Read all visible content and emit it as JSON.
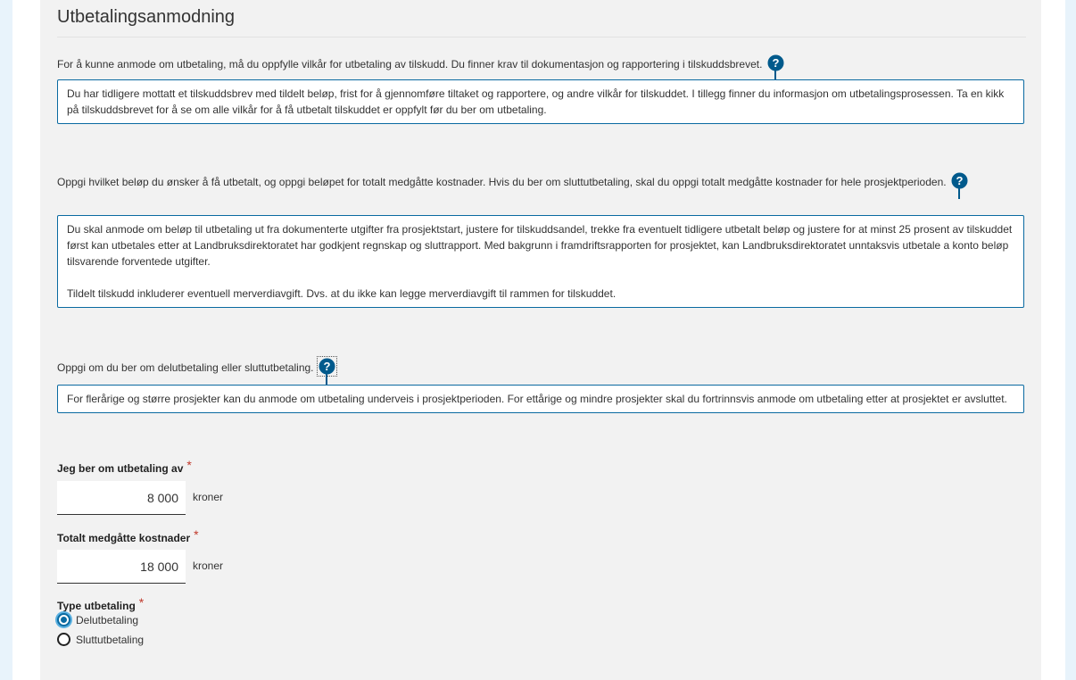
{
  "title": "Utbetalingsanmodning",
  "section1": {
    "intro": "For å kunne anmode om utbetaling, må du oppfylle vilkår for utbetaling av tilskudd. Du finner krav til dokumentasjon og rapportering i tilskuddsbrevet.",
    "help": "Du har tidligere mottatt et tilskuddsbrev med tildelt beløp, frist for å gjennomføre tiltaket og rapportere, og andre vilkår for tilskuddet. I tillegg finner du informasjon om utbetalingsprosessen. Ta en kikk på tilskuddsbrevet for å se om alle vilkår for å få utbetalt tilskuddet er oppfylt før du ber om utbetaling."
  },
  "section2": {
    "intro": "Oppgi hvilket beløp du ønsker å få utbetalt, og oppgi beløpet for totalt medgåtte kostnader. Hvis du ber om sluttutbetaling, skal du oppgi totalt medgåtte kostnader for hele prosjektperioden.",
    "help_p1": "Du skal anmode om beløp til utbetaling ut fra dokumenterte utgifter fra prosjektstart, justere for tilskuddsandel, trekke fra eventuelt tidligere utbetalt beløp og justere for at minst 25 prosent av tilskuddet først kan utbetales etter at Landbruksdirektoratet har godkjent regnskap og sluttrapport. Med bakgrunn i framdriftsrapporten for prosjektet, kan Landbruksdirektoratet unntaksvis utbetale a konto beløp tilsvarende forventede utgifter.",
    "help_p2": "Tildelt tilskudd inkluderer eventuell merverdiavgift. Dvs. at du ikke kan legge merverdiavgift til rammen for tilskuddet."
  },
  "section3": {
    "intro": "Oppgi om du ber om delutbetaling eller sluttutbetaling.",
    "help": "For flerårige og større prosjekter kan du anmode om utbetaling underveis i prosjektperioden. For ettårige og mindre prosjekter skal du fortrinnsvis anmode om utbetaling etter at prosjektet er avsluttet."
  },
  "form": {
    "amount_label": "Jeg ber om utbetaling av",
    "amount_value": "8 000",
    "costs_label": "Totalt medgåtte kostnader",
    "costs_value": "18 000",
    "unit": "kroner",
    "required_mark": "*",
    "type_label": "Type utbetaling",
    "options": [
      "Delutbetaling",
      "Sluttutbetaling"
    ],
    "selected": "Delutbetaling"
  },
  "colors": {
    "accent": "#0a6aa1",
    "help_icon": "#005a8c",
    "required": "#c0392b",
    "panel_bg": "#f2f2f2",
    "side_bar": "#e8f3fb"
  },
  "icons": {
    "help": "question-circle-icon"
  }
}
